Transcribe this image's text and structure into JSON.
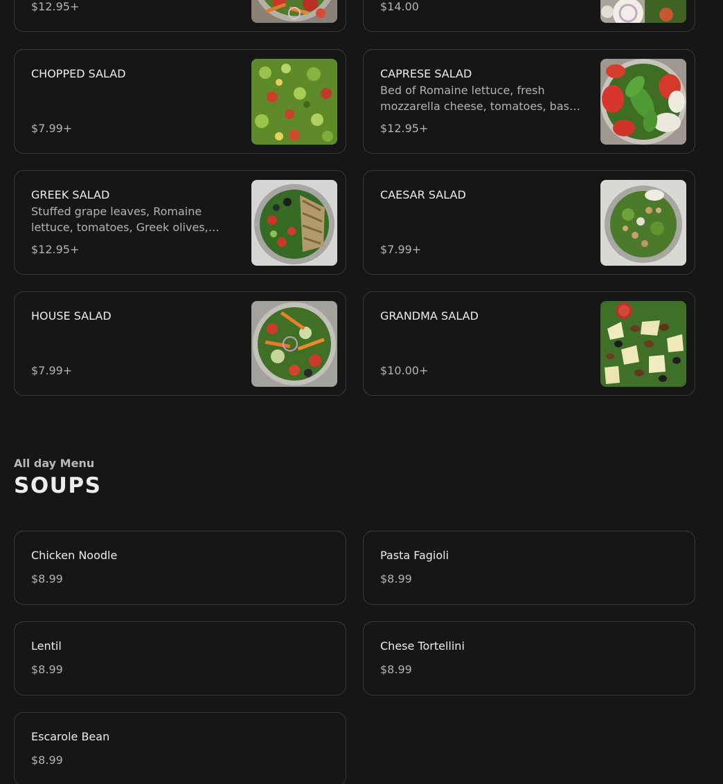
{
  "salads": {
    "items": [
      {
        "price": "$12.95+"
      },
      {
        "price": "$14.00"
      },
      {
        "name": "CHOPPED SALAD",
        "price": "$7.99+"
      },
      {
        "name": "CAPRESE SALAD",
        "description": "Bed of Romaine lettuce, fresh mozzarella cheese, tomatoes, basil, olive oil",
        "price": "$12.95+"
      },
      {
        "name": "GREEK SALAD",
        "description": "Stuffed grape leaves, Romaine lettuce, tomatoes, Greek olives, feta cheese",
        "price": "$12.95+"
      },
      {
        "name": "CAESAR SALAD",
        "price": "$7.99+"
      },
      {
        "name": "HOUSE SALAD",
        "price": "$7.99+"
      },
      {
        "name": "GRANDMA SALAD",
        "price": "$10.00+"
      }
    ]
  },
  "soups": {
    "kicker": "All day Menu",
    "title": "SOUPS",
    "items": [
      {
        "name": "Chicken Noodle",
        "price": "$8.99"
      },
      {
        "name": "Pasta Fagioli",
        "price": "$8.99"
      },
      {
        "name": "Lentil",
        "price": "$8.99"
      },
      {
        "name": "Chese Tortellini",
        "price": "$8.99"
      },
      {
        "name": "Escarole Bean",
        "price": "$8.99"
      }
    ]
  }
}
